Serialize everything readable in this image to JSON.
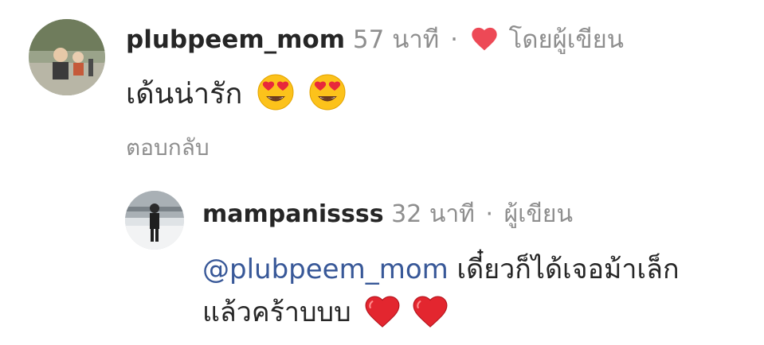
{
  "comment": {
    "username": "plubpeem_mom",
    "time": "57 นาที",
    "separator": "·",
    "liked_by_author": "โดยผู้เขียน",
    "text": "เด้นน่ารัก",
    "emojis": [
      "smiling-face-with-heart-eyes",
      "smiling-face-with-heart-eyes"
    ],
    "reply_label": "ตอบกลับ",
    "heart_color": "#ed4956"
  },
  "reply": {
    "username": "mampanissss",
    "time": "32 นาที",
    "separator": "·",
    "author_badge": "ผู้เขียน",
    "mention": "@plubpeem_mom",
    "text_line1": " เดี๋ยวก็ได้เจอม้าเล็ก",
    "text_line2": "แล้วคร้าบบบ",
    "emojis": [
      "red-heart",
      "red-heart"
    ]
  },
  "colors": {
    "text": "#262626",
    "secondary": "#8e8e8e",
    "mention": "#385898"
  }
}
